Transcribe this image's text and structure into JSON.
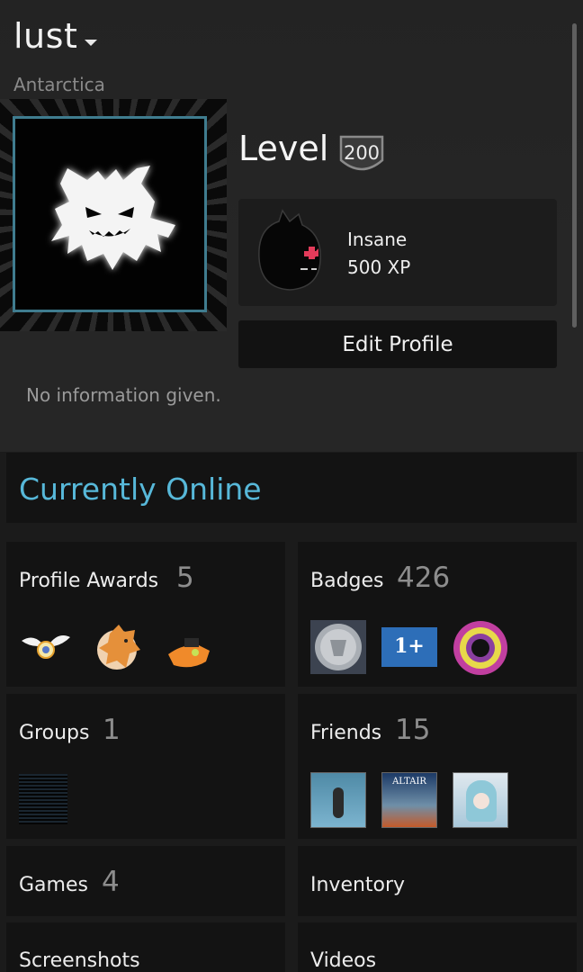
{
  "profile": {
    "username": "lust",
    "location": "Antarctica",
    "summary": "No information given."
  },
  "level": {
    "label": "Level",
    "value": "200"
  },
  "xp_badge": {
    "name": "Insane",
    "xp": "500 XP"
  },
  "buttons": {
    "edit_profile": "Edit Profile"
  },
  "status": {
    "online": "Currently Online"
  },
  "sections": {
    "profile_awards": {
      "label": "Profile Awards",
      "count": "5"
    },
    "badges": {
      "label": "Badges",
      "count": "426"
    },
    "groups": {
      "label": "Groups",
      "count": "1"
    },
    "friends": {
      "label": "Friends",
      "count": "15"
    },
    "games": {
      "label": "Games",
      "count": "4"
    },
    "inventory": {
      "label": "Inventory"
    },
    "screenshots": {
      "label": "Screenshots"
    },
    "videos": {
      "label": "Videos"
    }
  },
  "friend_thumbs": {
    "altair_title": "ALTAIR"
  },
  "badge_thumbs": {
    "one_plus": "1+"
  },
  "colors": {
    "accent_online": "#57b8d9",
    "background": "#1b1b1b",
    "card": "#131313",
    "avatar_border": "#3f7c8f"
  },
  "icons": [
    "dropdown-caret-icon",
    "level-shield-icon",
    "ghost-avatar-icon",
    "xp-creature-icon"
  ]
}
